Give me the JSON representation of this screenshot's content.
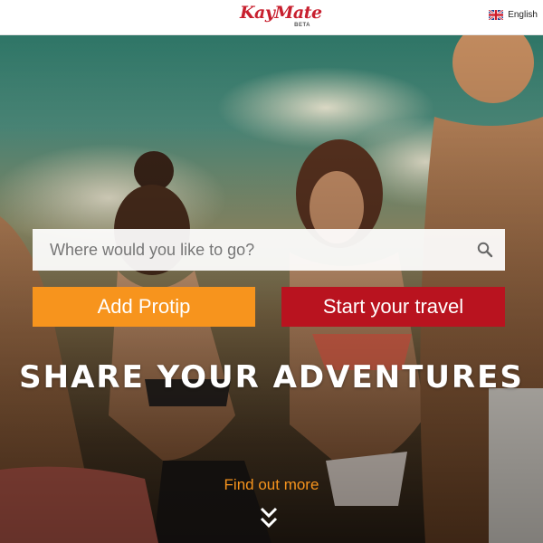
{
  "header": {
    "logo_text": "KayMate",
    "logo_badge": "BETA",
    "language": {
      "label": "English",
      "flag": "uk-flag-icon"
    }
  },
  "hero": {
    "search": {
      "placeholder": "Where would you like to go?",
      "icon": "search-icon"
    },
    "buttons": {
      "add_protip": "Add Protip",
      "start_travel": "Start your travel"
    },
    "headline": "SHARE YOUR ADVENTURES",
    "find_out_more": "Find out more",
    "scroll_icon": "double-chevron-down-icon"
  },
  "colors": {
    "brand_red": "#c8202f",
    "protip_orange": "#f7941d",
    "travel_red": "#b9131f"
  }
}
